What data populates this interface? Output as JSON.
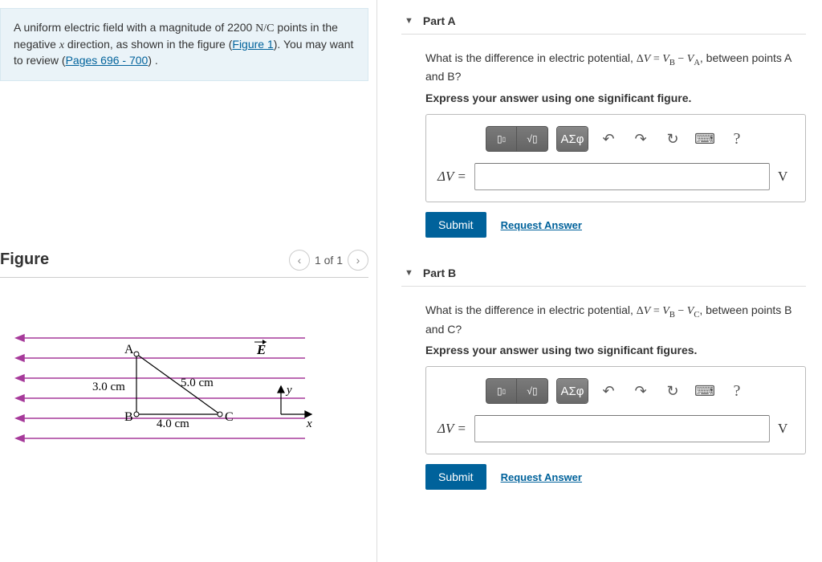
{
  "problem": {
    "text_pre": "A uniform electric field with a magnitude of 2200 ",
    "field_unit": "N/C",
    "text_mid1": " points in the negative ",
    "var_x": "x",
    "text_mid2": " direction, as shown in the figure (",
    "link_fig": "Figure 1",
    "text_mid3": "). You may want to review (",
    "link_pages": "Pages 696 - 700",
    "text_end": ") ."
  },
  "figure": {
    "title": "Figure",
    "pager": "1 of 1",
    "labels": {
      "A": "A",
      "B": "B",
      "C": "C",
      "E": "E",
      "y": "y",
      "x": "x"
    },
    "dims": {
      "ab": "3.0 cm",
      "ac": "5.0 cm",
      "bc": "4.0 cm"
    }
  },
  "partA": {
    "title": "Part A",
    "q_pre": "What is the difference in electric potential, ",
    "q_eq": "ΔV = V_B − V_A",
    "q_post": ", between points A and B?",
    "instruction": "Express your answer using one significant figure.",
    "answer_label": "ΔV =",
    "unit": "V",
    "submit": "Submit",
    "request": "Request Answer",
    "toolbar": {
      "tpl": "▢",
      "frac": "√▢",
      "greek": "ΑΣφ",
      "undo": "↶",
      "redo": "↷",
      "reset": "↻",
      "keyboard": "⌨",
      "help": "?"
    }
  },
  "partB": {
    "title": "Part B",
    "q_pre": "What is the difference in electric potential, ",
    "q_eq": "ΔV = V_B − V_C",
    "q_post": ", between points B and C?",
    "instruction": "Express your answer using two significant figures.",
    "answer_label": "ΔV =",
    "unit": "V",
    "submit": "Submit",
    "request": "Request Answer",
    "toolbar": {
      "tpl": "▢",
      "frac": "√▢",
      "greek": "ΑΣφ",
      "undo": "↶",
      "redo": "↷",
      "reset": "↻",
      "keyboard": "⌨",
      "help": "?"
    }
  }
}
